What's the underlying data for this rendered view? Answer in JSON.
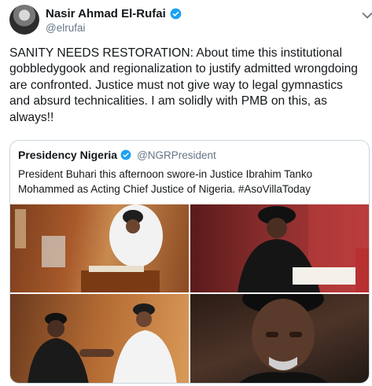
{
  "author": {
    "display_name": "Nasir Ahmad El-Rufai",
    "handle": "@elrufai",
    "verified_icon": "verified-badge-icon",
    "caret_icon": "chevron-down-icon"
  },
  "tweet": {
    "text": "SANITY NEEDS RESTORATION: About time this institutional gobbledygook and regionalization to justify admitted wrongdoing are confronted. Justice must not give way to legal gymnastics and absurd technicalities. I am solidly with PMB on this, as always!!"
  },
  "quoted_tweet": {
    "display_name": "Presidency Nigeria",
    "handle": "@NGRPresident",
    "text": "President Buhari this afternoon swore-in Justice Ibrahim Tanko Mohammed as Acting Chief Justice of Nigeria. #AsoVillaToday"
  },
  "colors": {
    "verified_blue": "#1da1f2",
    "text_primary": "#14171a",
    "text_secondary": "#657786",
    "border": "#ccd6dd"
  }
}
